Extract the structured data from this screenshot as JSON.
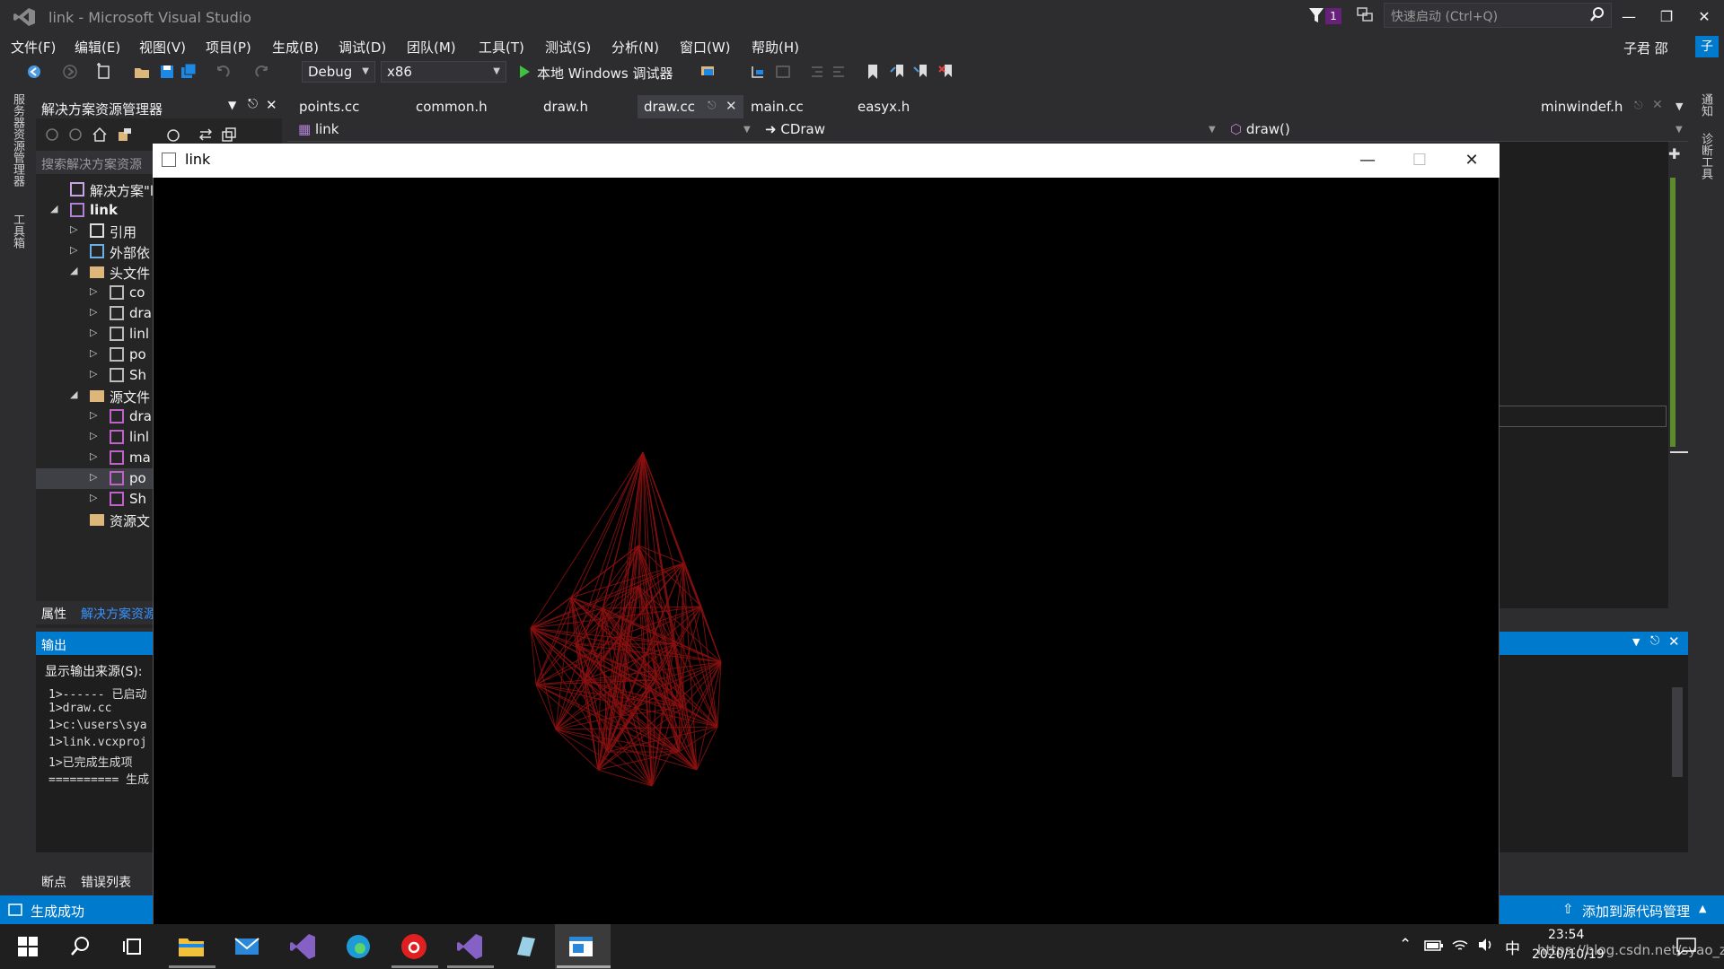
{
  "window": {
    "title": "link - Microsoft Visual Studio"
  },
  "notifications": {
    "count": "1"
  },
  "quick_launch": {
    "placeholder": "快速启动 (Ctrl+Q)"
  },
  "menu": [
    "文件(F)",
    "编辑(E)",
    "视图(V)",
    "项目(P)",
    "生成(B)",
    "调试(D)",
    "团队(M)",
    "工具(T)",
    "测试(S)",
    "分析(N)",
    "窗口(W)",
    "帮助(H)"
  ],
  "user": {
    "name": "子君 邵",
    "avatar": "子"
  },
  "toolbar": {
    "config": "Debug",
    "platform": "x86",
    "run_label": "本地 Windows 调试器"
  },
  "left_vertical_tabs": [
    "服务器资源管理器",
    "工具箱"
  ],
  "right_vertical_tabs": [
    "通知",
    "诊断工具"
  ],
  "solution_explorer": {
    "title": "解决方案资源管理器",
    "search_placeholder": "搜索解决方案资源",
    "tree": [
      {
        "label": "解决方案\"link",
        "depth": 0,
        "icon": "solution-icon",
        "expander": ""
      },
      {
        "label": "link",
        "depth": 0,
        "icon": "project-icon",
        "expander": "◢",
        "bold": true
      },
      {
        "label": "引用",
        "depth": 1,
        "icon": "references-icon",
        "expander": "▷"
      },
      {
        "label": "外部依",
        "depth": 1,
        "icon": "external-deps-icon",
        "expander": "▷"
      },
      {
        "label": "头文件",
        "depth": 1,
        "icon": "folder-icon",
        "expander": "◢"
      },
      {
        "label": "co",
        "depth": 2,
        "icon": "header-file-icon",
        "expander": "▷"
      },
      {
        "label": "dra",
        "depth": 2,
        "icon": "header-file-icon",
        "expander": "▷"
      },
      {
        "label": "linl",
        "depth": 2,
        "icon": "header-file-icon",
        "expander": "▷"
      },
      {
        "label": "po",
        "depth": 2,
        "icon": "header-file-icon",
        "expander": "▷"
      },
      {
        "label": "Sh",
        "depth": 2,
        "icon": "header-file-icon",
        "expander": "▷"
      },
      {
        "label": "源文件",
        "depth": 1,
        "icon": "folder-icon",
        "expander": "◢"
      },
      {
        "label": "dra",
        "depth": 2,
        "icon": "cpp-file-icon",
        "expander": "▷"
      },
      {
        "label": "linl",
        "depth": 2,
        "icon": "cpp-file-icon",
        "expander": "▷"
      },
      {
        "label": "ma",
        "depth": 2,
        "icon": "cpp-file-icon",
        "expander": "▷"
      },
      {
        "label": "po",
        "depth": 2,
        "icon": "cpp-file-icon",
        "expander": "▷"
      },
      {
        "label": "Sh",
        "depth": 2,
        "icon": "cpp-file-icon",
        "expander": "▷"
      },
      {
        "label": "资源文",
        "depth": 1,
        "icon": "folder-icon",
        "expander": ""
      }
    ],
    "bottom_tabs": [
      "属性",
      "解决方案资源"
    ]
  },
  "editor": {
    "tabs": [
      "points.cc",
      "common.h",
      "draw.h",
      "draw.cc",
      "main.cc",
      "easyx.h"
    ],
    "active_tab": "draw.cc",
    "right_tab": "minwindef.h",
    "nav": {
      "project": "link",
      "class": "CDraw",
      "member": "draw()"
    }
  },
  "output": {
    "title": "输出",
    "source_label": "显示输出来源(S):",
    "lines": [
      "1>------ 已启动",
      "1>draw.cc",
      "1>c:\\users\\sya",
      "1>link.vcxproj",
      "1>已完成生成项",
      "========== 生成"
    ],
    "bottom_tabs": [
      "断点",
      "错误列表"
    ]
  },
  "status": {
    "left": "生成成功",
    "right": "添加到源代码管理"
  },
  "child_window": {
    "title": "link"
  },
  "taskbar": {
    "time": "23:54",
    "date": "2020/10/19",
    "ime": "中",
    "watermark": "https://blog.csdn.net/syao_zj"
  },
  "colors": {
    "accent": "#007acc",
    "mesh": "#8b1010",
    "background": "#2d2d30"
  }
}
